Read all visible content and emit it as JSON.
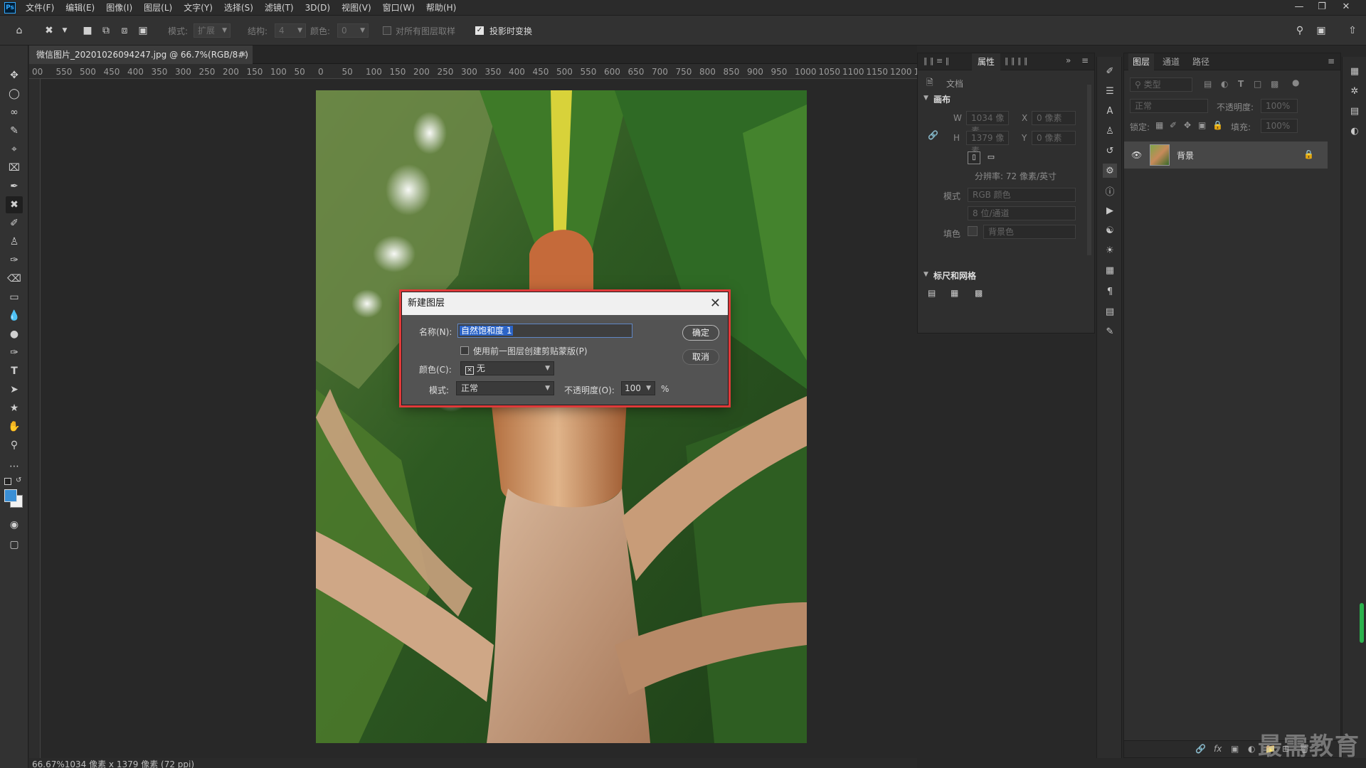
{
  "app": {
    "logo": "Ps",
    "menus": [
      "文件(F)",
      "编辑(E)",
      "图像(I)",
      "图层(L)",
      "文字(Y)",
      "选择(S)",
      "滤镜(T)",
      "3D(D)",
      "视图(V)",
      "窗口(W)",
      "帮助(H)"
    ]
  },
  "options_bar": {
    "mode_label": "模式:",
    "mode_value": "扩展",
    "structure_label": "结构:",
    "structure_value": "4",
    "color_label": "颜色:",
    "color_value": "0",
    "sample_all_label": "对所有图层取样",
    "transform_label": "投影时变换"
  },
  "document": {
    "tab_title": "微信图片_20201026094247.jpg @ 66.7%(RGB/8#)",
    "ruler_ticks": [
      "00",
      "550",
      "500",
      "450",
      "400",
      "350",
      "300",
      "250",
      "200",
      "150",
      "100",
      "50",
      "0",
      "50",
      "100",
      "150",
      "200",
      "250",
      "300",
      "350",
      "400",
      "450",
      "500",
      "550",
      "600",
      "650",
      "700",
      "750",
      "800",
      "850",
      "900",
      "950",
      "1000",
      "1050",
      "1100",
      "1150",
      "1200",
      "1"
    ],
    "status": "66.67%1034 像素 x 1379 像素 (72 ppi)"
  },
  "properties": {
    "tab_label": "属性",
    "doc_label": "文档",
    "canvas_head": "画布",
    "w_label": "W",
    "w_value": "1034 像素",
    "h_label": "H",
    "h_value": "1379 像素",
    "x_label": "X",
    "x_value": "0 像素",
    "y_label": "Y",
    "y_value": "0 像素",
    "resolution": "分辨率: 72 像素/英寸",
    "mode_label": "模式",
    "mode_value": "RGB 颜色",
    "depth_value": "8 位/通道",
    "fill_label": "填色",
    "fill_value": "背景色",
    "rulers_head": "标尺和网格"
  },
  "layers": {
    "tabs": [
      "图层",
      "通道",
      "路径"
    ],
    "filter_placeholder": "类型",
    "blend_mode": "正常",
    "opacity_label": "不透明度:",
    "opacity_value": "100%",
    "lock_label": "锁定:",
    "fill_label": "填充:",
    "fill_value": "100%",
    "layer_name": "背景"
  },
  "dialog": {
    "title": "新建图层",
    "name_label": "名称(N):",
    "name_value": "自然饱和度 1",
    "clip_label": "使用前一图层创建剪贴蒙版(P)",
    "color_label": "颜色(C):",
    "color_value": "无",
    "mode_label": "模式:",
    "mode_value": "正常",
    "opacity_label": "不透明度(O):",
    "opacity_value": "100",
    "percent": "%",
    "ok": "确定",
    "cancel": "取消"
  },
  "watermark": "最需教育",
  "colors": {
    "highlight": "#e03a3a",
    "selection": "#2b64c8",
    "foreground_swatch": "#3a8fd6"
  }
}
